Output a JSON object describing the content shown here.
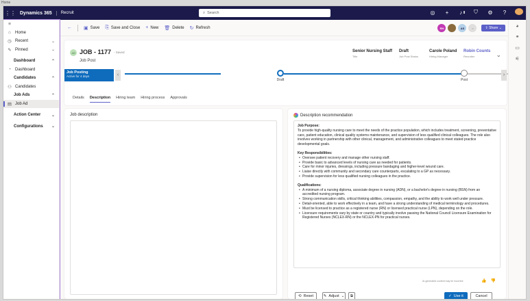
{
  "frame_label": "Home",
  "topbar": {
    "app_name": "Dynamics 365",
    "area": "Recruit",
    "search_placeholder": "Search",
    "notification_count": "1"
  },
  "sidebar": {
    "items": [
      {
        "label": "Home",
        "icon": "home-icon"
      },
      {
        "label": "Recent",
        "icon": "clock-icon"
      },
      {
        "label": "Pinned",
        "icon": "pin-icon"
      }
    ],
    "groups": [
      {
        "label": "Dashboard",
        "items": [
          "Dashboard"
        ]
      },
      {
        "label": "Candidates",
        "items": [
          "Candidates"
        ]
      },
      {
        "label": "Job Ads",
        "items": [
          "Job Ad"
        ]
      },
      {
        "label": "Action Center"
      },
      {
        "label": "Configurations"
      }
    ]
  },
  "cmdbar": {
    "save": "Save",
    "save_close": "Save and Close",
    "new": "New",
    "delete": "Delete",
    "refresh": "Refresh",
    "share": "Share",
    "presence": [
      "RH",
      "",
      "AS",
      ""
    ]
  },
  "record": {
    "badge": "JO",
    "title": "JOB - 1177",
    "saved": "- Saved",
    "type": "Job Post",
    "fields": [
      {
        "value": "Senior Nursing Staff",
        "label": "Title"
      },
      {
        "value": "Draft",
        "label": "Job Post Status"
      },
      {
        "value": "Carole Poland",
        "label": "Hiring Manager"
      },
      {
        "value": "Robin Counts",
        "label": "Recruiter"
      }
    ]
  },
  "bpf": {
    "process": "Job Posting",
    "duration": "Active for 4 days",
    "stages": [
      "Draft",
      "Post"
    ]
  },
  "tabs": [
    "Details",
    "Description",
    "Hiring team",
    "Hiring process",
    "Approvals"
  ],
  "left_panel": {
    "title": "Job description"
  },
  "right_panel": {
    "title": "Description recommendation",
    "purpose_head": "Job Purpose:",
    "purpose_text": "To provide high-quality nursing care to meet the needs of the practice population, which includes treatment, screening, preventative care, patient education, clinical quality systems maintenance, and supervision of less qualified clinical colleagues. The role also involves working in partnership with other clinical, management, and administrative colleagues to meet stated practice developmental goals.",
    "resp_head": "Key Responsibilities:",
    "responsibilities": [
      "Oversee patient recovery and manage other nursing staff.",
      "Provide basic to advanced levels of nursing care as needed for patients.",
      "Care for minor injuries, dressings, including pressure bandaging and higher-level wound care.",
      "Liaise directly with community and secondary care counterparts, escalating to a GP as necessary.",
      "Provide supervision for less qualified nursing colleagues in the practice."
    ],
    "qual_head": "Qualifications:",
    "qualifications": [
      "A minimum of a nursing diploma, associate degree in nursing (ADN), or a bachelor's degree in nursing (BSN) from an accredited nursing program.",
      "Strong communication skills, critical thinking abilities, compassion, empathy, and the ability to work well under pressure.",
      "Detail-oriented, able to work effectively in a team, and have a strong understanding of medical terminology and procedures.",
      "Must be licensed to practice as a registered nurse (RN) or licensed practical nurse (LPN), depending on the role.",
      "Licensure requirements vary by state or country and typically involve passing the National Council Licensure Examination for Registered Nurses (NCLEX-RN) or the NCLEX-PN for practical nurses."
    ],
    "disclaimer": "AI-generated content may be incorrect",
    "reset": "Reset",
    "adjust": "Adjust",
    "use_it": "Use it",
    "cancel": "Cancel"
  }
}
